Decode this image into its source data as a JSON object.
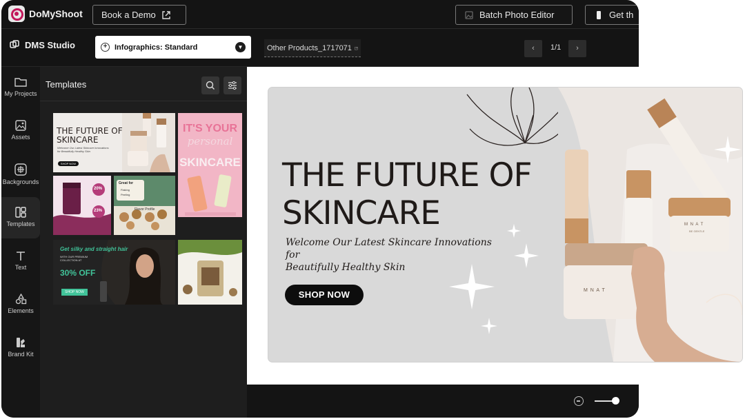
{
  "brand": {
    "name": "DoMyShoot"
  },
  "topbar": {
    "book_demo": "Book a Demo",
    "batch_editor": "Batch Photo Editor",
    "get_app": "Get th"
  },
  "studio": {
    "name": "DMS Studio"
  },
  "template_select": {
    "value": "Infographics: Standard"
  },
  "product_name": "Other Products_1717071",
  "pagination": {
    "label": "1/1",
    "prev": "‹",
    "next": "›"
  },
  "rail": {
    "items": [
      {
        "label": "My Projects",
        "icon": "folder-icon"
      },
      {
        "label": "Assets",
        "icon": "image-icon"
      },
      {
        "label": "Backgrounds",
        "icon": "backgrounds-icon"
      },
      {
        "label": "Templates",
        "icon": "templates-icon"
      },
      {
        "label": "Text",
        "icon": "text-icon"
      },
      {
        "label": "Elements",
        "icon": "elements-icon"
      },
      {
        "label": "Brand Kit",
        "icon": "brand-kit-icon"
      }
    ]
  },
  "panel": {
    "title": "Templates"
  },
  "thumbs": {
    "t1": {
      "title_1": "THE FUTURE OF",
      "title_2": "SKINCARE",
      "sub": "Welcome Our Latest Skincare Innovations for Beautifully Healthy Skin",
      "cta": "SHOP NOW"
    },
    "t2": {
      "title_1": "IT'S YOUR",
      "title_2": "personal",
      "title_3": "SKINCARE"
    },
    "t3": {
      "pct_1": "20%",
      "pct_2": "23%"
    },
    "t4": {
      "head": "Great for",
      "item_1": "Flaking",
      "item_2": "Peeling",
      "caption": "Flavor Profile"
    },
    "t5": {
      "head": "Get silky and straight hair",
      "body": "WITH OUR PREMIUM COLLECTION AT",
      "offer": "30% OFF",
      "cta": "SHOP NOW"
    },
    "t6": {}
  },
  "banner": {
    "title_line_1": "THE FUTURE OF",
    "title_line_2": "SKINCARE",
    "subtitle_line_1": "Welcome Our Latest Skincare Innovations for",
    "subtitle_line_2": "Beautifully Healthy Skin",
    "cta": "SHOP NOW",
    "jar_brand": "M  N  A  T",
    "jar2_brand": "M  N  A  T",
    "jar2_sub": "BE GENTLE"
  },
  "colors": {
    "app_bg": "#121212",
    "panel_bg": "#1e1e1e",
    "banner_bg": "#d9d9d9",
    "accent_brand": "#c2185b"
  }
}
